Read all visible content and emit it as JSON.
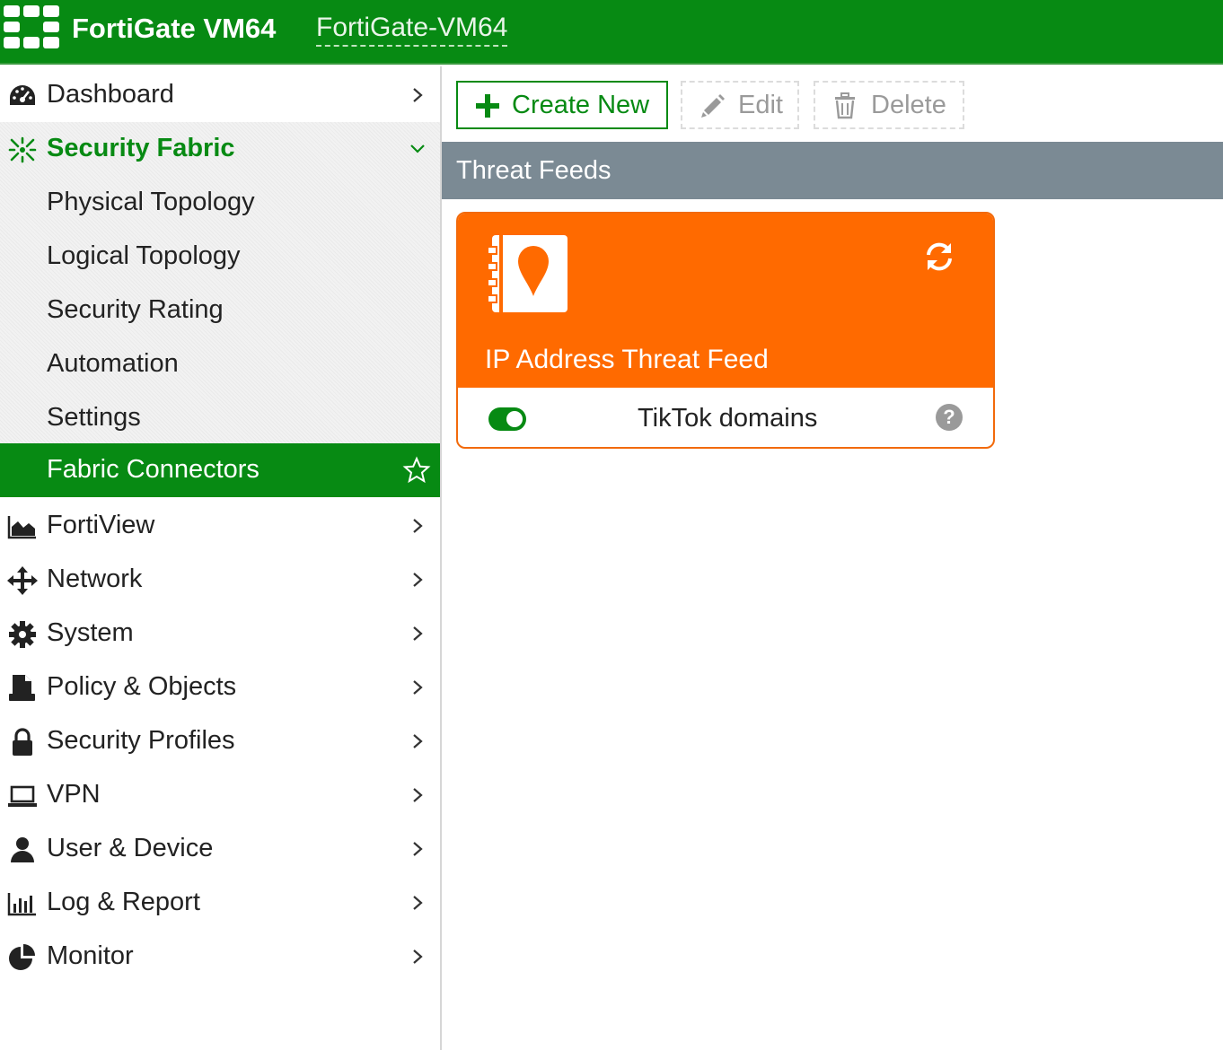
{
  "header": {
    "product": "FortiGate VM64",
    "hostname": "FortiGate-VM64"
  },
  "sidebar": {
    "items": [
      {
        "label": "Dashboard",
        "icon": "dashboard-icon"
      },
      {
        "label": "Security Fabric",
        "icon": "security-fabric-icon",
        "expanded": true
      },
      {
        "label": "Physical Topology"
      },
      {
        "label": "Logical Topology"
      },
      {
        "label": "Security Rating"
      },
      {
        "label": "Automation"
      },
      {
        "label": "Settings"
      },
      {
        "label": "Fabric Connectors",
        "active": true
      },
      {
        "label": "FortiView",
        "icon": "area-chart-icon"
      },
      {
        "label": "Network",
        "icon": "arrows-move-icon"
      },
      {
        "label": "System",
        "icon": "gear-icon"
      },
      {
        "label": "Policy & Objects",
        "icon": "document-stamp-icon"
      },
      {
        "label": "Security Profiles",
        "icon": "lock-icon"
      },
      {
        "label": "VPN",
        "icon": "laptop-icon"
      },
      {
        "label": "User & Device",
        "icon": "user-icon"
      },
      {
        "label": "Log & Report",
        "icon": "bar-chart-icon"
      },
      {
        "label": "Monitor",
        "icon": "pie-chart-icon"
      }
    ]
  },
  "toolbar": {
    "create_label": "Create New",
    "edit_label": "Edit",
    "delete_label": "Delete"
  },
  "section": {
    "title": "Threat Feeds"
  },
  "card": {
    "type_label": "IP Address Threat Feed",
    "name": "TikTok domains",
    "enabled": true,
    "help": "?"
  },
  "colors": {
    "brand_green": "#078a13",
    "card_orange": "#ff6a00",
    "section_gray": "#7b8a94"
  }
}
